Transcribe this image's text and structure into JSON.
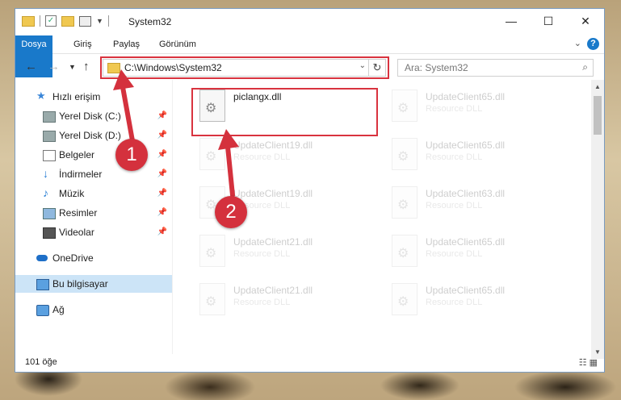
{
  "window": {
    "title": "System32",
    "minimize": "—",
    "maximize": "☐",
    "close": "✕"
  },
  "ribbon": {
    "tabs": [
      "Dosya",
      "Giriş",
      "Paylaş",
      "Görünüm"
    ],
    "help": "?"
  },
  "address": {
    "path": "C:\\Windows\\System32",
    "refresh": "↻"
  },
  "search": {
    "placeholder": "Ara: System32"
  },
  "sidebar": {
    "items": [
      {
        "label": "Hızlı erişim",
        "icon": "star-icon"
      },
      {
        "label": "Yerel Disk (C:)",
        "icon": "drive-icon"
      },
      {
        "label": "Yerel Disk (D:)",
        "icon": "drive-icon"
      },
      {
        "label": "Belgeler",
        "icon": "documents-icon"
      },
      {
        "label": "İndirmeler",
        "icon": "download-icon"
      },
      {
        "label": "Müzik",
        "icon": "music-icon"
      },
      {
        "label": "Resimler",
        "icon": "pictures-icon"
      },
      {
        "label": "Videolar",
        "icon": "videos-icon"
      },
      {
        "label": "OneDrive",
        "icon": "cloud-icon"
      },
      {
        "label": "Bu bilgisayar",
        "icon": "computer-icon"
      },
      {
        "label": "Ağ",
        "icon": "network-icon"
      }
    ]
  },
  "files": [
    {
      "name": "piclangx.dll",
      "type": ""
    },
    {
      "name": "UpdateClient65.dll",
      "type": "Resource DLL"
    },
    {
      "name": "UpdateClient19.dll",
      "type": "Resource DLL"
    },
    {
      "name": "UpdateClient65.dll",
      "type": "Resource DLL"
    },
    {
      "name": "UpdateClient19.dll",
      "type": "Resource DLL"
    },
    {
      "name": "UpdateClient63.dll",
      "type": "Resource DLL"
    },
    {
      "name": "UpdateClient21.dll",
      "type": "Resource DLL"
    },
    {
      "name": "UpdateClient65.dll",
      "type": "Resource DLL"
    },
    {
      "name": "UpdateClient21.dll",
      "type": "Resource DLL"
    },
    {
      "name": "UpdateClient65.dll",
      "type": "Resource DLL"
    }
  ],
  "status": {
    "count": "101 öğe"
  },
  "annotations": {
    "step1": "1",
    "step2": "2",
    "color": "#d4313d"
  }
}
